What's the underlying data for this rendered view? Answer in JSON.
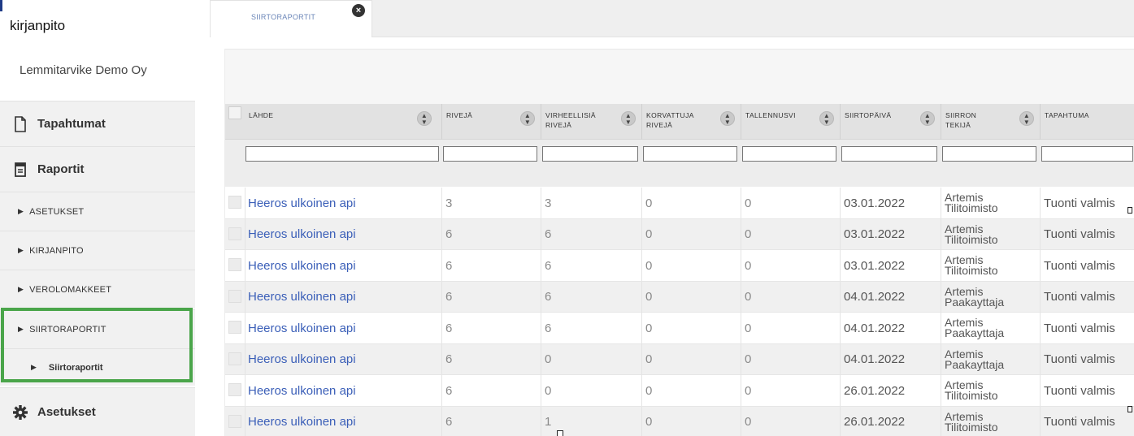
{
  "app": {
    "title": "kirjanpito",
    "company": "Lemmitarvike Demo Oy"
  },
  "sidebar": {
    "items": [
      {
        "label": "Tapahtumat",
        "icon": "document-icon"
      },
      {
        "label": "Raportit",
        "icon": "report-icon"
      },
      {
        "label": "ASETUKSET"
      },
      {
        "label": "KIRJANPITO"
      },
      {
        "label": "VEROLOMAKKEET"
      },
      {
        "label": "SIIRTORAPORTIT"
      },
      {
        "label": "Siirtoraportit"
      },
      {
        "label": "Asetukset",
        "icon": "gear-icon"
      }
    ]
  },
  "tabs": [
    {
      "label": "SIIRTORAPORTIT"
    }
  ],
  "grid": {
    "columns": [
      {
        "label": "LÄHDE"
      },
      {
        "label": "RIVEJÄ"
      },
      {
        "label": "VIRHEELLISIÄ RIVEJÄ"
      },
      {
        "label": "KORVATTUJA RIVEJÄ"
      },
      {
        "label": "TALLENNUSVI"
      },
      {
        "label": "SIIRTOPÄIVÄ"
      },
      {
        "label": "SIIRRON TEKIJÄ"
      },
      {
        "label": "TAPAHTUMA"
      }
    ],
    "rows": [
      {
        "source": "Heeros ulkoinen api",
        "rows": "3",
        "errors": "3",
        "replaced": "0",
        "saved": "0",
        "date": "03.01.2022",
        "author1": "Artemis",
        "author2": "Tilitoimisto",
        "event": "Tuonti valmis"
      },
      {
        "source": "Heeros ulkoinen api",
        "rows": "6",
        "errors": "6",
        "replaced": "0",
        "saved": "0",
        "date": "03.01.2022",
        "author1": "Artemis",
        "author2": "Tilitoimisto",
        "event": "Tuonti valmis"
      },
      {
        "source": "Heeros ulkoinen api",
        "rows": "6",
        "errors": "6",
        "replaced": "0",
        "saved": "0",
        "date": "03.01.2022",
        "author1": "Artemis",
        "author2": "Tilitoimisto",
        "event": "Tuonti valmis"
      },
      {
        "source": "Heeros ulkoinen api",
        "rows": "6",
        "errors": "6",
        "replaced": "0",
        "saved": "0",
        "date": "04.01.2022",
        "author1": "Artemis",
        "author2": "Paakayttaja",
        "event": "Tuonti valmis"
      },
      {
        "source": "Heeros ulkoinen api",
        "rows": "6",
        "errors": "6",
        "replaced": "0",
        "saved": "0",
        "date": "04.01.2022",
        "author1": "Artemis",
        "author2": "Paakayttaja",
        "event": "Tuonti valmis"
      },
      {
        "source": "Heeros ulkoinen api",
        "rows": "6",
        "errors": "0",
        "replaced": "0",
        "saved": "0",
        "date": "04.01.2022",
        "author1": "Artemis",
        "author2": "Paakayttaja",
        "event": "Tuonti valmis"
      },
      {
        "source": "Heeros ulkoinen api",
        "rows": "6",
        "errors": "0",
        "replaced": "0",
        "saved": "0",
        "date": "26.01.2022",
        "author1": "Artemis",
        "author2": "Tilitoimisto",
        "event": "Tuonti valmis"
      },
      {
        "source": "Heeros ulkoinen api",
        "rows": "6",
        "errors": "1",
        "replaced": "0",
        "saved": "0",
        "date": "26.01.2022",
        "author1": "Artemis",
        "author2": "Tilitoimisto",
        "event": "Tuonti valmis"
      }
    ]
  },
  "colors": {
    "accent_link": "#3b5fb8",
    "highlight_border": "#4aa54a",
    "tab_label": "#6b86b8"
  }
}
